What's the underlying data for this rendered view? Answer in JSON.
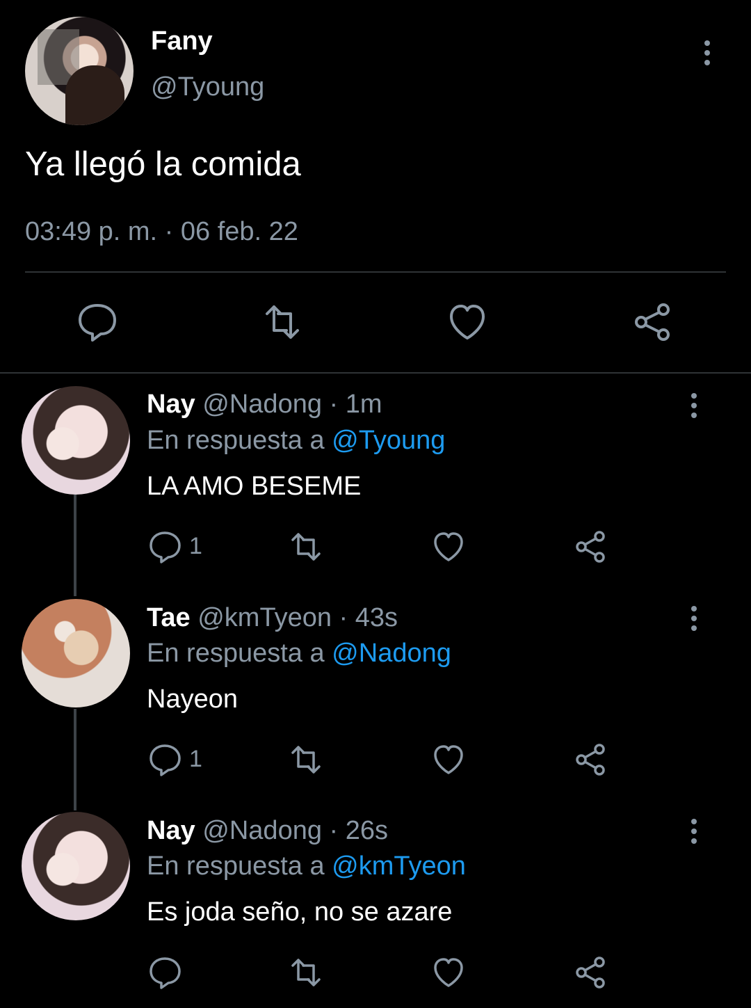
{
  "colors": {
    "background": "#000000",
    "primary_text": "#ffffff",
    "secondary_text": "#8b98a5",
    "divider": "#2f3336",
    "mention": "#1d9bf0",
    "icon": "#8b98a5"
  },
  "main_tweet": {
    "display_name": "Fany",
    "handle": "@Tyoung",
    "text": "Ya llegó la comida",
    "meta": "03:49 p. m. · 06 feb. 22",
    "menu_icon": "more-vertical-icon",
    "actions": [
      {
        "icon": "reply-icon"
      },
      {
        "icon": "retweet-icon"
      },
      {
        "icon": "like-icon"
      },
      {
        "icon": "share-icon"
      }
    ]
  },
  "replies": [
    {
      "display_name": "Nay",
      "handle": "@Nadong",
      "time": "· 1m",
      "reply_prefix": "En respuesta a",
      "reply_to": "@Tyoung",
      "text": "LA AMO BESEME",
      "reply_count": "1",
      "menu_icon": "more-vertical-icon"
    },
    {
      "display_name": "Tae",
      "handle": "@kmTyeon",
      "time": "· 43s",
      "reply_prefix": "En respuesta a",
      "reply_to": "@Nadong",
      "text": "Nayeon",
      "reply_count": "1",
      "menu_icon": "more-vertical-icon"
    },
    {
      "display_name": "Nay",
      "handle": "@Nadong",
      "time": "· 26s",
      "reply_prefix": "En respuesta a",
      "reply_to": "@kmTyeon",
      "text": "Es joda seño, no se azare",
      "reply_count": "",
      "menu_icon": "more-vertical-icon"
    }
  ]
}
